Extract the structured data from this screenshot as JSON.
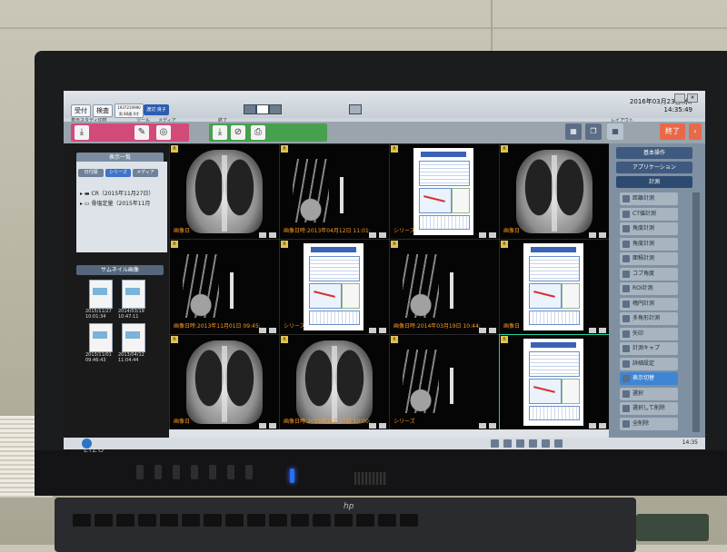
{
  "header": {
    "reception_label": "受付",
    "exam_label": "検査",
    "patient_id": "1937219990",
    "patient_meta": "男 80歳 0才",
    "patient_name": "渡辺 良子",
    "datetime_line1": "2016年03月23日(水)",
    "datetime_line2": "14:35:49",
    "labels": [
      "表示スタディ切替",
      "ツール",
      "メディア",
      "終了",
      "レイアウト"
    ],
    "exit_label": "終了"
  },
  "left_panel": {
    "list_header": "表示一覧",
    "tabs": [
      "日付順",
      "シリーズ",
      "メディア"
    ],
    "studies": [
      "CR（2015年11月27日）",
      "骨塩定量（2015年11月"
    ],
    "thumb_header": "サムネイル画像",
    "thumbs": [
      {
        "date": "2015/11/27",
        "time": "10:01:34"
      },
      {
        "date": "2014/03/19",
        "time": "10:47:11"
      },
      {
        "date": "2013/11/01",
        "time": "09:46:43"
      },
      {
        "date": "2013/04/12",
        "time": "11:04:44"
      }
    ]
  },
  "grid": {
    "cells": [
      {
        "type": "cxr",
        "overlay": "画像日"
      },
      {
        "type": "hand",
        "overlay": "画像日時:2013年04月12日 11:01:"
      },
      {
        "type": "report",
        "overlay": "シリーズ"
      },
      {
        "type": "cxr",
        "overlay": "画像日"
      },
      {
        "type": "hand",
        "overlay": "画像日時:2013年11月01日 09:45:"
      },
      {
        "type": "report",
        "overlay": "シリーズ"
      },
      {
        "type": "hand",
        "overlay": "画像日時:2014年03月19日 10:44:"
      },
      {
        "type": "report",
        "overlay": "画像日"
      },
      {
        "type": "cxr",
        "overlay": "画像日"
      },
      {
        "type": "cxr",
        "overlay": "画像日時:2015年11月27日 10:00:"
      },
      {
        "type": "hand",
        "overlay": "シリーズ"
      },
      {
        "type": "report",
        "overlay": ""
      }
    ]
  },
  "right_panel": {
    "heads": [
      "基本操作",
      "アプリケーション",
      "計測"
    ],
    "items": [
      "距離計測",
      "CT値計測",
      "角度計測",
      "角度計測",
      "面積計測",
      "コブ角度",
      "ROI計測",
      "楕円計測",
      "多角形計測",
      "矢印",
      "計測キャプ",
      "詳細設定",
      "表示切替",
      "選択",
      "選択して削除",
      "全削除"
    ]
  },
  "taskbar": {
    "time": "14:35"
  },
  "monitor": {
    "brand": "EIZO",
    "keyboard_brand": "hp"
  }
}
